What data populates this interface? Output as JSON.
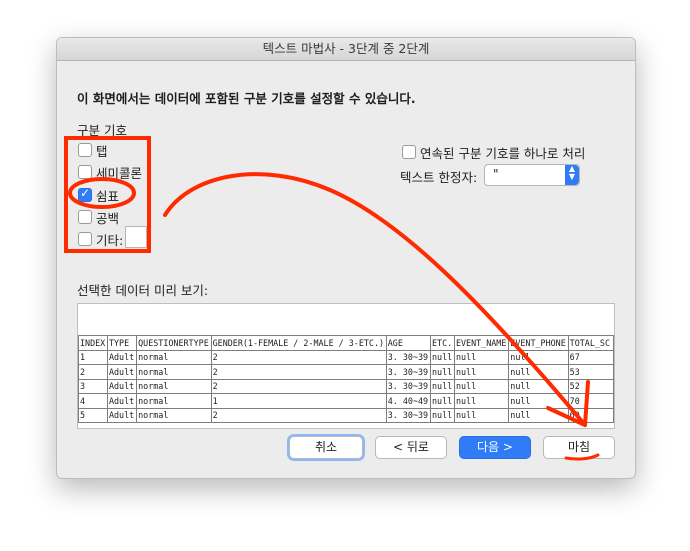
{
  "window": {
    "title": "텍스트 마법사 - 3단계 중 2단계"
  },
  "instruction": "이 화면에서는 데이터에 포함된 구분 기호를 설정할 수 있습니다.",
  "delimiters": {
    "group_label": "구분 기호",
    "tab": {
      "label": "탭",
      "checked": false
    },
    "semicolon": {
      "label": "세미콜론",
      "checked": false
    },
    "comma": {
      "label": "쉼표",
      "checked": true
    },
    "space": {
      "label": "공백",
      "checked": false
    },
    "other": {
      "label": "기타:",
      "checked": false,
      "value": ""
    }
  },
  "options": {
    "consecutive": {
      "label": "연속된 구분 기호를 하나로 처리",
      "checked": false
    },
    "qualifier_label": "텍스트 한정자:",
    "qualifier_value": "\""
  },
  "preview": {
    "label": "선택한 데이터 미리 보기:",
    "rows": [
      [
        "INDEX",
        "TYPE",
        "QUESTIONERTYPE",
        "GENDER(1-FEMALE / 2-MALE / 3-ETC.)",
        "AGE",
        "ETC.",
        "EVENT_NAME",
        "EVENT_PHONE",
        "TOTAL_SC"
      ],
      [
        "1",
        "Adult",
        "normal",
        "2",
        "3. 30~39",
        "null",
        "null",
        "null",
        "67"
      ],
      [
        "2",
        "Adult",
        "normal",
        "2",
        "3. 30~39",
        "null",
        "null",
        "null",
        "53"
      ],
      [
        "3",
        "Adult",
        "normal",
        "2",
        "3. 30~39",
        "null",
        "null",
        "null",
        "52"
      ],
      [
        "4",
        "Adult",
        "normal",
        "1",
        "4. 40~49",
        "null",
        "null",
        "null",
        "70"
      ],
      [
        "5",
        "Adult",
        "normal",
        "2",
        "3. 30~39",
        "null",
        "null",
        "null",
        "60"
      ]
    ]
  },
  "buttons": {
    "cancel": "취소",
    "back": "< 뒤로",
    "next": "다음 >",
    "finish": "마침"
  },
  "colors": {
    "accent": "#2f7cf6",
    "annotation": "#ff2a00"
  }
}
